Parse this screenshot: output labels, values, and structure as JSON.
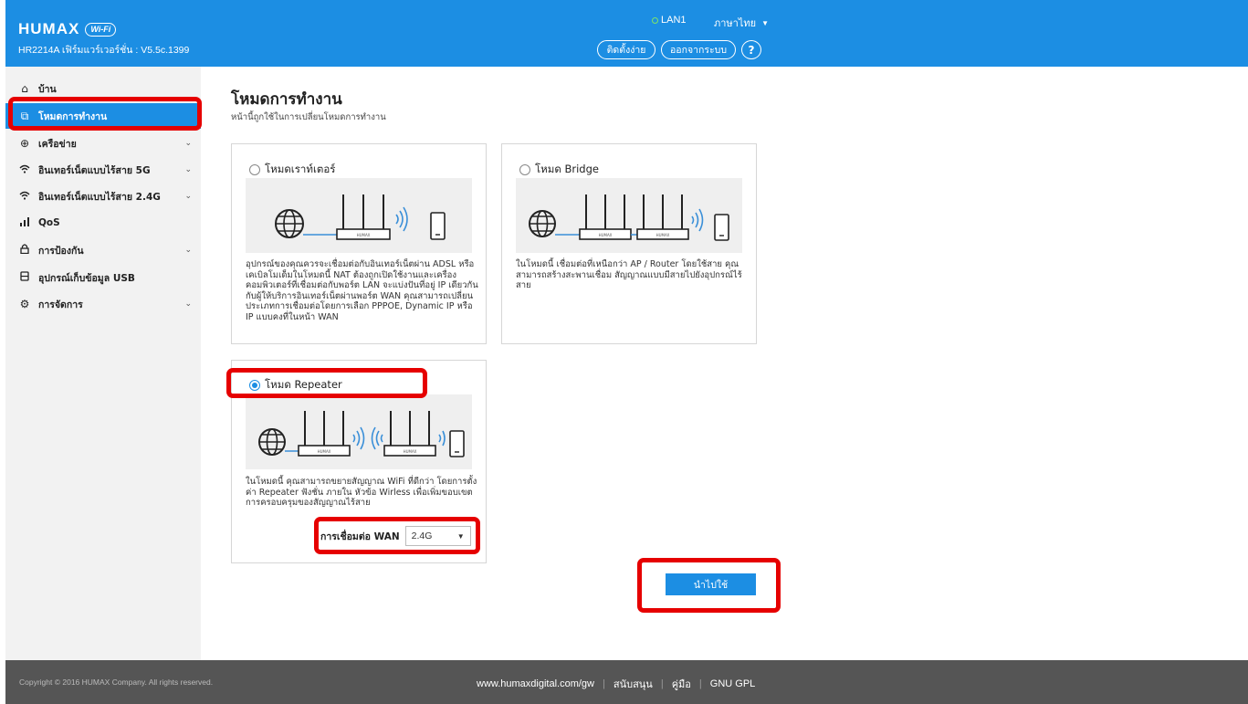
{
  "header": {
    "logo": "HUMAX",
    "wifi_badge": "Wi-Fi",
    "model_firmware": "HR2214A เฟิร์มแวร์เวอร์ชั่น : V5.5c.1399",
    "lan_status": "LAN1",
    "language": "ภาษาไทย",
    "setup_button": "ติดตั้งง่าย",
    "logout_button": "ออกจากระบบ",
    "help_button": "?"
  },
  "sidebar": {
    "items": [
      {
        "label": "บ้าน",
        "icon": "home-icon",
        "expandable": false
      },
      {
        "label": "โหมดการทำงาน",
        "icon": "mode-icon",
        "expandable": false,
        "active": true
      },
      {
        "label": "เครือข่าย",
        "icon": "globe-icon",
        "expandable": true
      },
      {
        "label": "อินเทอร์เน็ตแบบไร้สาย 5G",
        "icon": "wifi-icon",
        "expandable": true
      },
      {
        "label": "อินเทอร์เน็ตแบบไร้สาย 2.4G",
        "icon": "wifi-icon",
        "expandable": true
      },
      {
        "label": "QoS",
        "icon": "bar-chart-icon",
        "expandable": false
      },
      {
        "label": "การป้องกัน",
        "icon": "lock-icon",
        "expandable": true
      },
      {
        "label": "อุปกรณ์เก็บข้อมูล USB",
        "icon": "usb-storage-icon",
        "expandable": false
      },
      {
        "label": "การจัดการ",
        "icon": "gear-icon",
        "expandable": true
      }
    ]
  },
  "main": {
    "title": "โหมดการทำงาน",
    "subtitle": "หน้านี้ถูกใช้ในการเปลี่ยนโหมดการทำงาน",
    "modes": {
      "router": {
        "label": "โหมดเราท์เตอร์",
        "selected": false,
        "description": "อุปกรณ์ของคุณควรจะเชื่อมต่อกับอินเทอร์เน็ตผ่าน ADSL หรือเคเบิลโมเด็มในโหมดนี้ NAT ต้องถูกเปิดใช้งานและเครื่องคอมพิวเตอร์ที่เชื่อมต่อกับพอร์ต LAN จะแบ่งปันที่อยู่ IP เดียวกันกับผู้ให้บริการอินเทอร์เน็ตผ่านพอร์ต WAN คุณสามารถเปลี่ยนประเภทการเชื่อมต่อโดยการเลือก PPPOE, Dynamic IP หรือ IP แบบคงที่ในหน้า WAN"
      },
      "bridge": {
        "label": "โหมด Bridge",
        "selected": false,
        "description": "ในโหมดนี้ เชื่อมต่อที่เหนือกว่า AP / Router โดยใช้สาย คุณสามารถสร้างสะพานเชื่อม สัญญาณแบบมีสายไปยังอุปกรณ์ไร้สาย"
      },
      "repeater": {
        "label": "โหมด Repeater",
        "selected": true,
        "description": "ในโหมดนี้ คุณสามารถขยายสัญญาณ WiFi ที่ดีกว่า โดยการตั้งค่า Repeater ฟังชั่น ภายใน หัวข้อ Wirless เพื่อเพิ่มขอบเขตการครอบครุมของสัญญาณไร้สาย",
        "wan_label": "การเชื่อมต่อ WAN",
        "wan_value": "2.4G"
      }
    },
    "router_brand": "HUMAX",
    "apply_button": "นำไปใช้"
  },
  "footer": {
    "copyright": "Copyright © 2016 HUMAX Company. All rights reserved.",
    "links": [
      "www.humaxdigital.com/gw",
      "สนับสนุน",
      "คู่มือ",
      "GNU GPL"
    ]
  },
  "colors": {
    "primary": "#1c8ee3",
    "highlight": "#e60000",
    "footer": "#555555",
    "sidebar": "#f2f2f2"
  }
}
